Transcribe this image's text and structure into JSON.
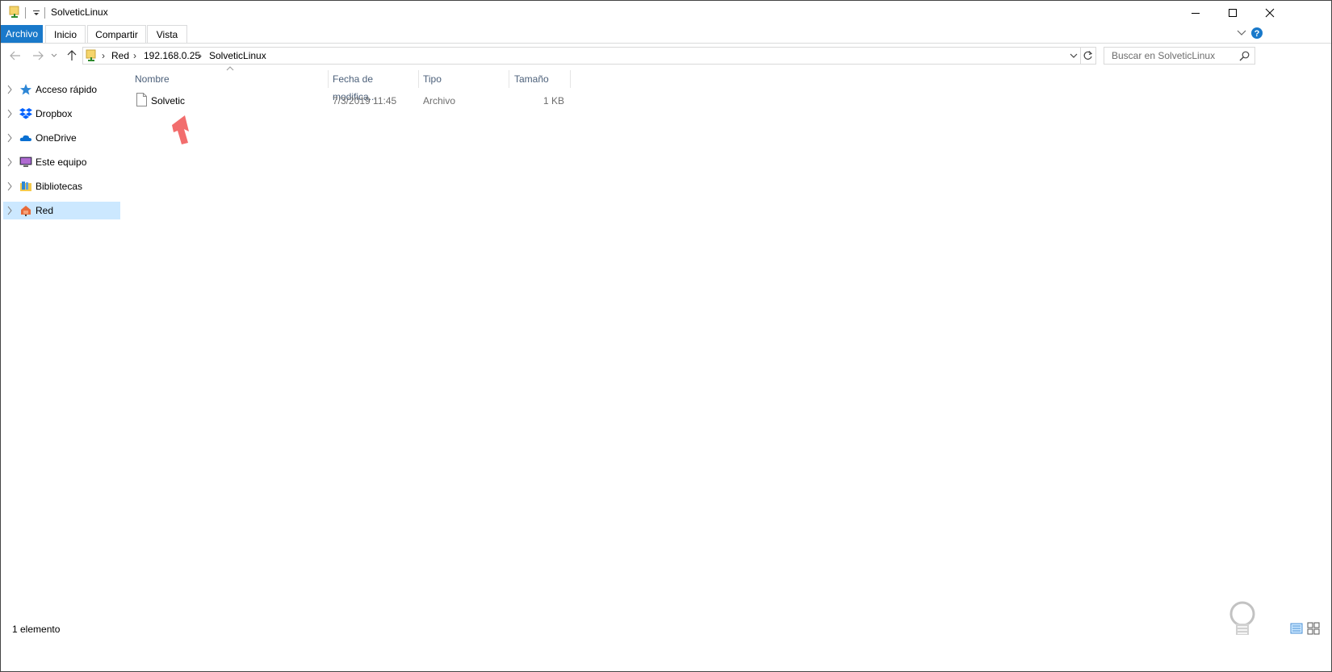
{
  "window": {
    "title": "SolveticLinux",
    "controls": {
      "minimize": "minimize",
      "maximize": "maximize",
      "close": "close"
    }
  },
  "ribbon": {
    "file_tab": "Archivo",
    "tabs": [
      "Inicio",
      "Compartir",
      "Vista"
    ]
  },
  "nav": {
    "breadcrumb": [
      "Red",
      "192.168.0.25",
      "SolveticLinux"
    ],
    "search_placeholder": "Buscar en SolveticLinux"
  },
  "sidebar": {
    "items": [
      {
        "label": "Acceso rápido",
        "icon": "star-icon"
      },
      {
        "label": "Dropbox",
        "icon": "dropbox-icon"
      },
      {
        "label": "OneDrive",
        "icon": "onedrive-icon"
      },
      {
        "label": "Este equipo",
        "icon": "computer-icon"
      },
      {
        "label": "Bibliotecas",
        "icon": "libraries-icon"
      },
      {
        "label": "Red",
        "icon": "network-icon",
        "selected": true
      }
    ]
  },
  "file_list": {
    "columns": [
      "Nombre",
      "Fecha de modifica...",
      "Tipo",
      "Tamaño"
    ],
    "rows": [
      {
        "name": "Solvetic",
        "date": "7/3/2019 11:45",
        "type": "Archivo",
        "size": "1 KB"
      }
    ]
  },
  "status_bar": {
    "count": "1 elemento"
  },
  "colors": {
    "accent": "#1979ca",
    "selected_bg": "#cce8ff",
    "annotation_arrow": "#f26d6d"
  }
}
